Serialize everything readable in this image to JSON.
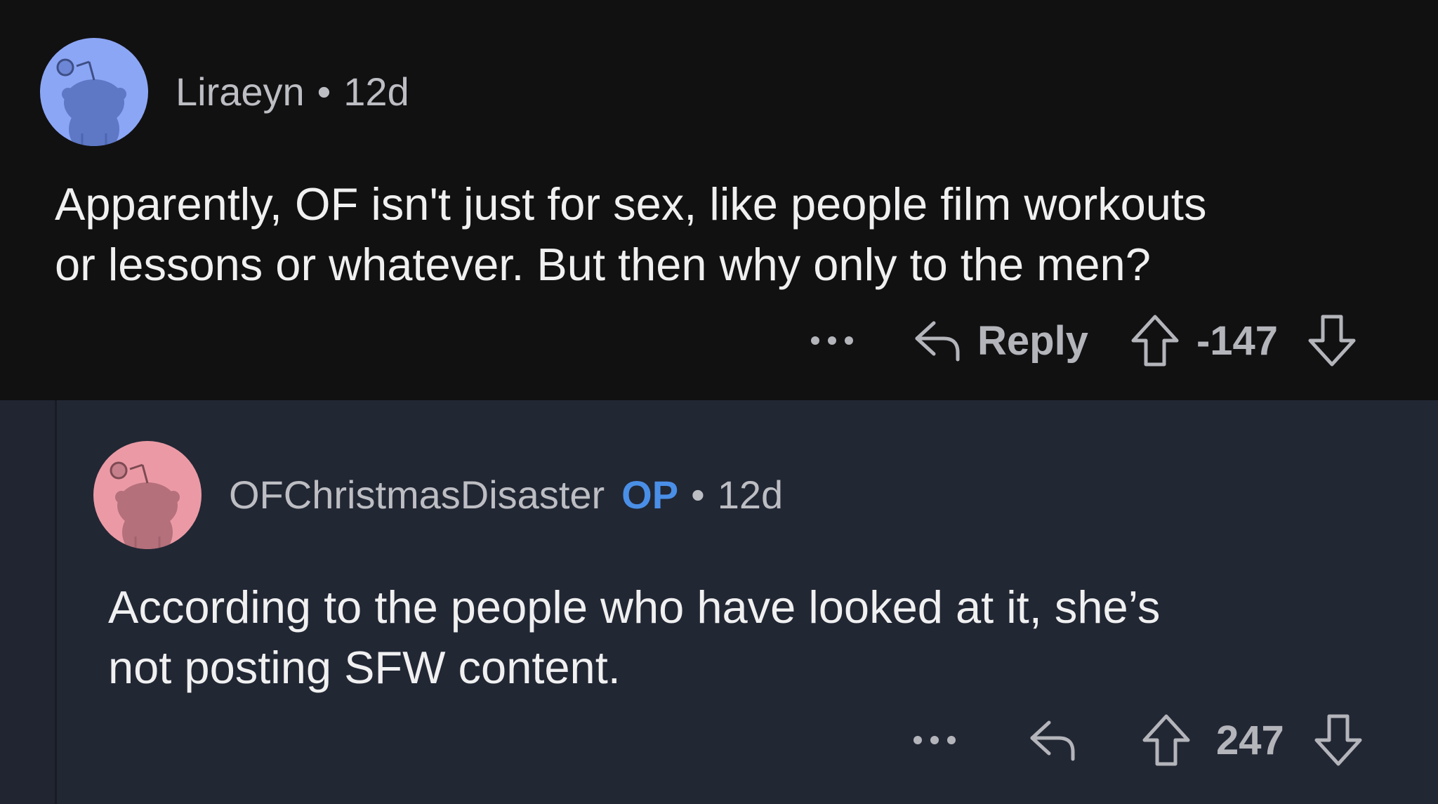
{
  "comments": [
    {
      "username": "Liraeyn",
      "separator": "•",
      "age": "12d",
      "body_lines": [
        "Apparently, OF isn't just for sex, like people film workouts",
        "or lessons or whatever.  But then why only to the men?"
      ],
      "reply_label": "Reply",
      "score": "-147",
      "avatar_color": "#8ca6f6"
    },
    {
      "username": "OFChristmasDisaster",
      "op_badge": "OP",
      "separator": "•",
      "age": "12d",
      "body_lines": [
        "According to the people who have looked at it, she’s",
        "not posting SFW content."
      ],
      "score": "247",
      "avatar_color": "#eb9aa5"
    }
  ],
  "icons": {
    "more": "more-options-icon",
    "reply": "reply-arrow-icon",
    "upvote": "upvote-arrow-icon",
    "downvote": "downvote-arrow-icon",
    "avatar": "snoo-avatar-icon"
  },
  "colors": {
    "background_top": "#111112",
    "background_reply": "#222734",
    "op_badge": "#4a8fe7",
    "text": "#f0f0f1",
    "muted": "#bdbec3"
  }
}
